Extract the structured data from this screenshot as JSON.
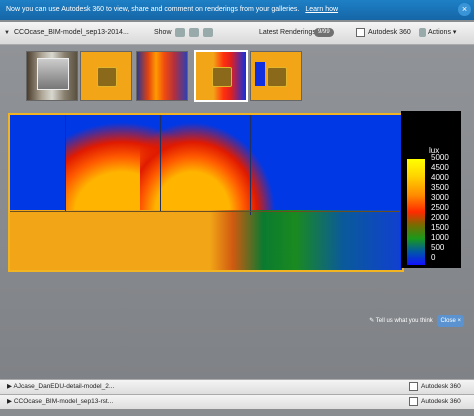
{
  "infobar": {
    "message": "Now you can use Autodesk 360 to view, share and comment on renderings from your galleries.",
    "link": "Learn how",
    "close": "×"
  },
  "toolbar": {
    "collapse": "▼",
    "filename": "CCOcase_BIM-model_sep13-2014...",
    "show_label": "Show",
    "latest_label": "Latest Renderings",
    "latest_count": "9/99",
    "autodesk_label": "Autodesk 360",
    "actions_label": "Actions",
    "actions_caret": "▾"
  },
  "legend": {
    "unit": "lux",
    "ticks": [
      "5000",
      "4500",
      "4000",
      "3500",
      "3000",
      "2500",
      "2000",
      "1500",
      "1000",
      "500",
      "0"
    ]
  },
  "feedback": {
    "text": "Tell us what you think",
    "close": "Close ×"
  },
  "files": [
    {
      "arrow": "▶",
      "name": "AJcase_DanEDU-detail-model_2...",
      "autodesk": "Autodesk 360"
    },
    {
      "arrow": "▶",
      "name": "CCOcase_BIM-model_sep13-rst...",
      "autodesk": "Autodesk 360"
    }
  ],
  "colors": {
    "accent": "#1e80c6",
    "viewer_border": "#f2b521",
    "selection": "#ffffff"
  }
}
